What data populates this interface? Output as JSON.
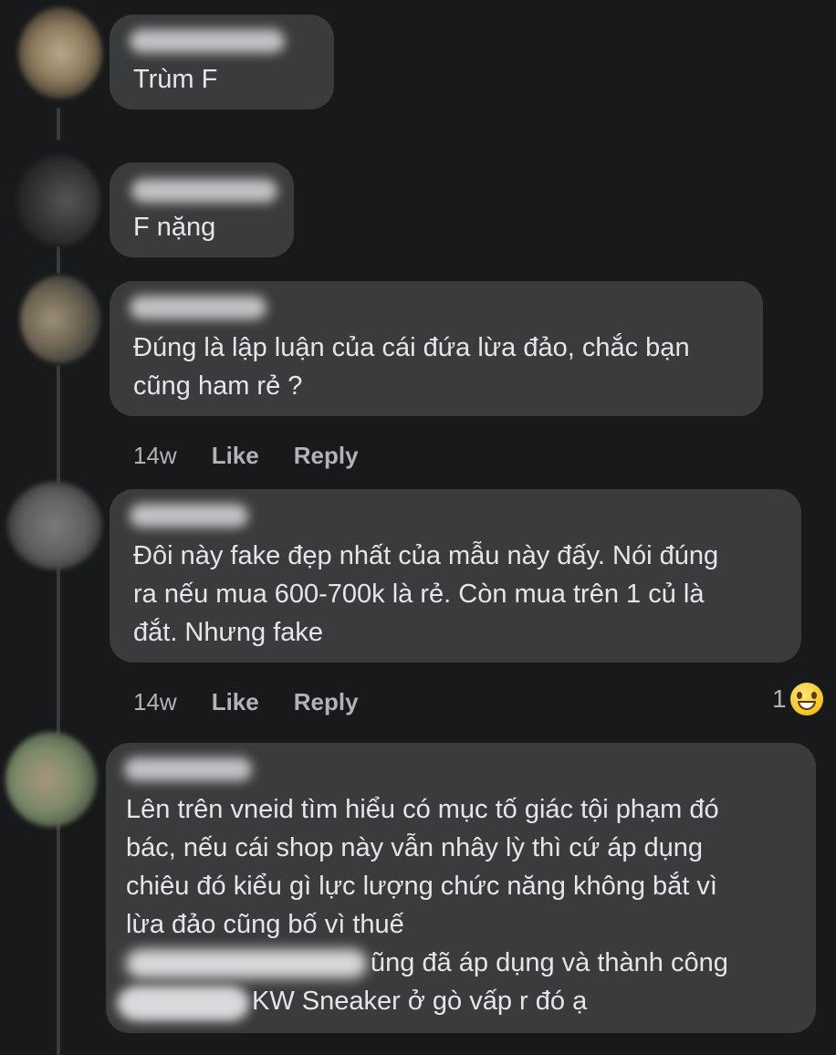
{
  "comments": [
    {
      "text": "Trùm F"
    },
    {
      "text": "F nặng"
    },
    {
      "text": "Đúng là lập luận của cái đứa lừa đảo, chắc bạn\ncũng ham rẻ ?",
      "time": "14w",
      "like": "Like",
      "reply": "Reply"
    },
    {
      "text": "Đôi này fake đẹp nhất của mẫu này đấy. Nói đúng\nra nếu mua 600-700k là rẻ. Còn mua trên 1 củ là\nđắt. Nhưng fake",
      "time": "14w",
      "like": "Like",
      "reply": "Reply",
      "reaction_count": "1",
      "reaction_icon": "grinning-face-icon"
    },
    {
      "text": "Lên trên vneid tìm hiểu có mục tố giác tội phạm đó\nbác, nếu cái shop này vẫn nhây lỳ thì cứ áp dụng\nchiêu đó kiểu gì lực lượng chức năng không bắt vì\nlừa đảo cũng bố vì thuế",
      "line5": "ũng đã áp dụng và thành công",
      "line6": "KW Sneaker ở gò vấp r đó ạ"
    }
  ],
  "colors": {
    "background": "#18191a",
    "bubble": "#3a3b3c",
    "text": "#e4e6eb",
    "meta": "#b0b3b8"
  }
}
